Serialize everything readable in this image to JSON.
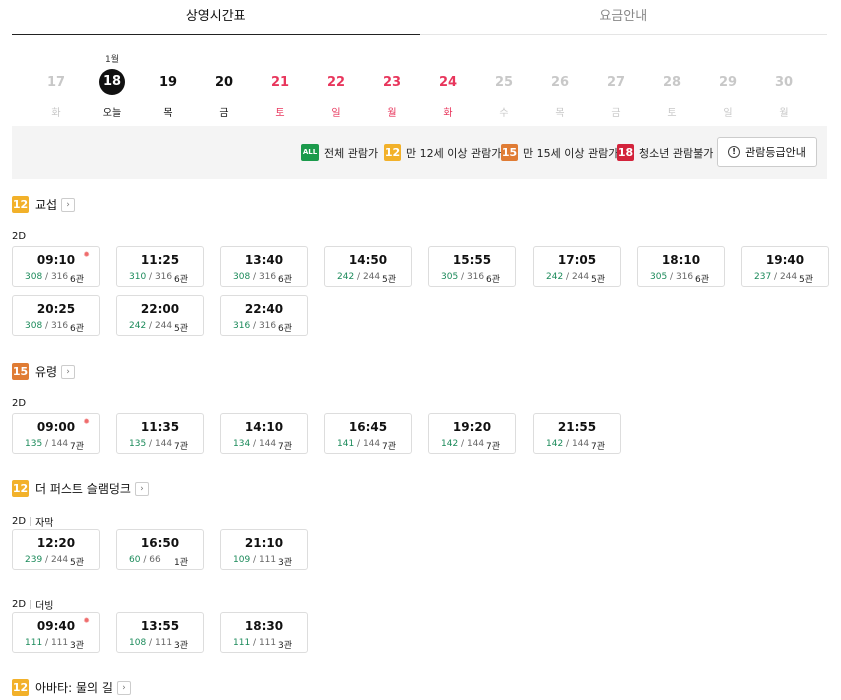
{
  "tabs": [
    {
      "label": "상영시간표",
      "active": true
    },
    {
      "label": "요금안내",
      "active": false
    }
  ],
  "dates": [
    {
      "month": "",
      "day": "17",
      "dow": "화",
      "tone": "gray"
    },
    {
      "month": "1월",
      "day": "18",
      "dow": "오늘",
      "tone": "dark",
      "selected": true
    },
    {
      "month": "",
      "day": "19",
      "dow": "목",
      "tone": "dark"
    },
    {
      "month": "",
      "day": "20",
      "dow": "금",
      "tone": "dark"
    },
    {
      "month": "",
      "day": "21",
      "dow": "토",
      "tone": "red"
    },
    {
      "month": "",
      "day": "22",
      "dow": "일",
      "tone": "red"
    },
    {
      "month": "",
      "day": "23",
      "dow": "월",
      "tone": "red"
    },
    {
      "month": "",
      "day": "24",
      "dow": "화",
      "tone": "red"
    },
    {
      "month": "",
      "day": "25",
      "dow": "수",
      "tone": "gray"
    },
    {
      "month": "",
      "day": "26",
      "dow": "목",
      "tone": "gray"
    },
    {
      "month": "",
      "day": "27",
      "dow": "금",
      "tone": "gray"
    },
    {
      "month": "",
      "day": "28",
      "dow": "토",
      "tone": "gray"
    },
    {
      "month": "",
      "day": "29",
      "dow": "일",
      "tone": "gray"
    },
    {
      "month": "",
      "day": "30",
      "dow": "월",
      "tone": "gray"
    }
  ],
  "ratings": [
    {
      "badge": "ALL",
      "label": "전체 관람가"
    },
    {
      "badge": "12",
      "label": "만 12세 이상 관람가"
    },
    {
      "badge": "15",
      "label": "만 15세 이상 관람가"
    },
    {
      "badge": "18",
      "label": "청소년 관람불가"
    }
  ],
  "rating_guide_button": "관람등급안내",
  "info_icon": "!",
  "colors": {
    "rating_all": "#1b9a4b",
    "rating_12": "#f2b12a",
    "rating_15": "#e07c34",
    "rating_18": "#d3233b",
    "weekend_red": "#e8365c",
    "seats_green": "#1b8a5a"
  },
  "movies": [
    {
      "rating": "12",
      "title": "교섭",
      "groups": [
        {
          "format": "2D",
          "subtitle": "",
          "slots": [
            {
              "time": "09:10",
              "avail": "308",
              "total": "316",
              "hall": "6관",
              "morning": true
            },
            {
              "time": "11:25",
              "avail": "310",
              "total": "316",
              "hall": "6관"
            },
            {
              "time": "13:40",
              "avail": "308",
              "total": "316",
              "hall": "6관"
            },
            {
              "time": "14:50",
              "avail": "242",
              "total": "244",
              "hall": "5관"
            },
            {
              "time": "15:55",
              "avail": "305",
              "total": "316",
              "hall": "6관"
            },
            {
              "time": "17:05",
              "avail": "242",
              "total": "244",
              "hall": "5관"
            },
            {
              "time": "18:10",
              "avail": "305",
              "total": "316",
              "hall": "6관"
            },
            {
              "time": "19:40",
              "avail": "237",
              "total": "244",
              "hall": "5관"
            },
            {
              "time": "20:25",
              "avail": "308",
              "total": "316",
              "hall": "6관"
            },
            {
              "time": "22:00",
              "avail": "242",
              "total": "244",
              "hall": "5관"
            },
            {
              "time": "22:40",
              "avail": "316",
              "total": "316",
              "hall": "6관"
            }
          ]
        }
      ]
    },
    {
      "rating": "15",
      "title": "유령",
      "groups": [
        {
          "format": "2D",
          "subtitle": "",
          "slots": [
            {
              "time": "09:00",
              "avail": "135",
              "total": "144",
              "hall": "7관",
              "morning": true
            },
            {
              "time": "11:35",
              "avail": "135",
              "total": "144",
              "hall": "7관"
            },
            {
              "time": "14:10",
              "avail": "134",
              "total": "144",
              "hall": "7관"
            },
            {
              "time": "16:45",
              "avail": "141",
              "total": "144",
              "hall": "7관"
            },
            {
              "time": "19:20",
              "avail": "142",
              "total": "144",
              "hall": "7관"
            },
            {
              "time": "21:55",
              "avail": "142",
              "total": "144",
              "hall": "7관"
            }
          ]
        }
      ]
    },
    {
      "rating": "12",
      "title": "더 퍼스트 슬램덩크",
      "groups": [
        {
          "format": "2D",
          "subtitle": "자막",
          "slots": [
            {
              "time": "12:20",
              "avail": "239",
              "total": "244",
              "hall": "5관"
            },
            {
              "time": "16:50",
              "avail": "60",
              "total": "66",
              "hall": "1관"
            },
            {
              "time": "21:10",
              "avail": "109",
              "total": "111",
              "hall": "3관"
            }
          ]
        },
        {
          "format": "2D",
          "subtitle": "더빙",
          "slots": [
            {
              "time": "09:40",
              "avail": "111",
              "total": "111",
              "hall": "3관",
              "morning": true
            },
            {
              "time": "13:55",
              "avail": "108",
              "total": "111",
              "hall": "3관"
            },
            {
              "time": "18:30",
              "avail": "111",
              "total": "111",
              "hall": "3관"
            }
          ]
        }
      ]
    },
    {
      "rating": "12",
      "title": "아바타: 물의 길",
      "groups": []
    }
  ]
}
